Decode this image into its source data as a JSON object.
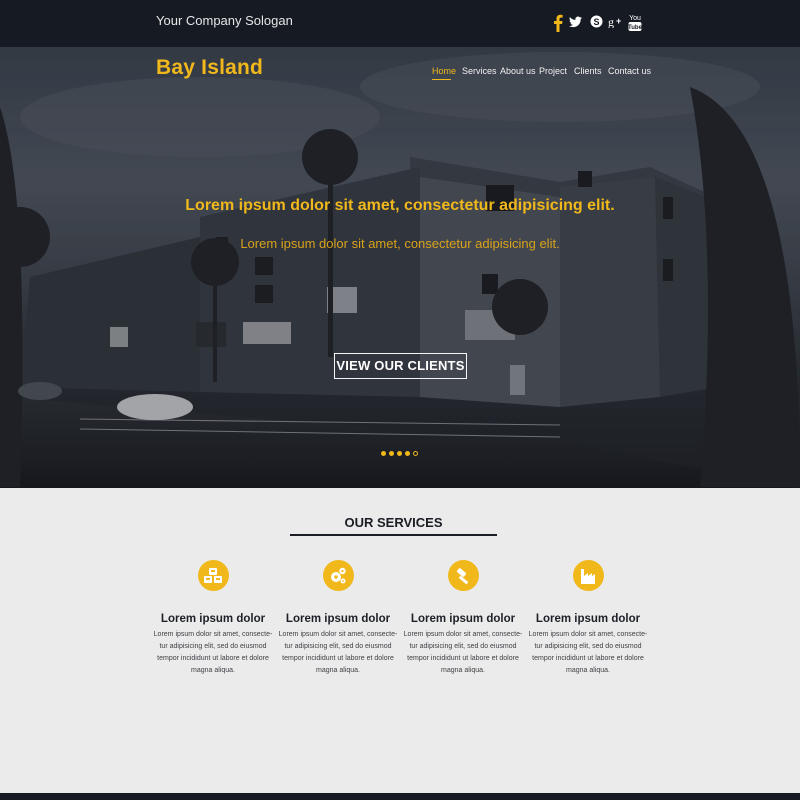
{
  "topbar": {
    "slogan": "Your Company Sologan",
    "social": [
      "facebook-icon",
      "twitter-icon",
      "skype-icon",
      "google-plus-icon",
      "youtube-icon"
    ],
    "youtube_text": "You"
  },
  "brand": {
    "logo": "Bay Island",
    "accent": "#f0b81b"
  },
  "nav": {
    "items": [
      "Home",
      "Services",
      "About us",
      "Project",
      "Clients",
      "Contact us"
    ],
    "active": "Home"
  },
  "hero": {
    "headline": "Lorem ipsum dolor sit amet, consectetur adipisicing elit.",
    "subline": "Lorem ipsum dolor sit amet, consectetur adipisicing elit.",
    "cta": "VIEW OUR CLIENTS",
    "slides_total": 5,
    "slide_active": 4
  },
  "services": {
    "title": "OUR SERVICES",
    "items": [
      {
        "icon": "cubes-icon",
        "title": "Lorem ipsum dolor",
        "text": "Lorem ipsum dolor sit amet, consecte-tur adipisicing elit, sed do eiusmod tempor incididunt ut labore et dolore magna aliqua."
      },
      {
        "icon": "gears-icon",
        "title": "Lorem ipsum dolor",
        "text": "Lorem ipsum dolor sit amet, consecte-tur adipisicing elit, sed do eiusmod tempor incididunt ut labore et dolore magna aliqua."
      },
      {
        "icon": "gavel-icon",
        "title": "Lorem ipsum dolor",
        "text": "Lorem ipsum dolor sit amet, consecte-tur adipisicing elit, sed do eiusmod tempor incididunt ut labore et dolore magna aliqua."
      },
      {
        "icon": "factory-icon",
        "title": "Lorem ipsum dolor",
        "text": "Lorem ipsum dolor sit amet, consecte-tur adipisicing elit, sed do eiusmod tempor incididunt ut labore et dolore magna aliqua."
      }
    ]
  }
}
